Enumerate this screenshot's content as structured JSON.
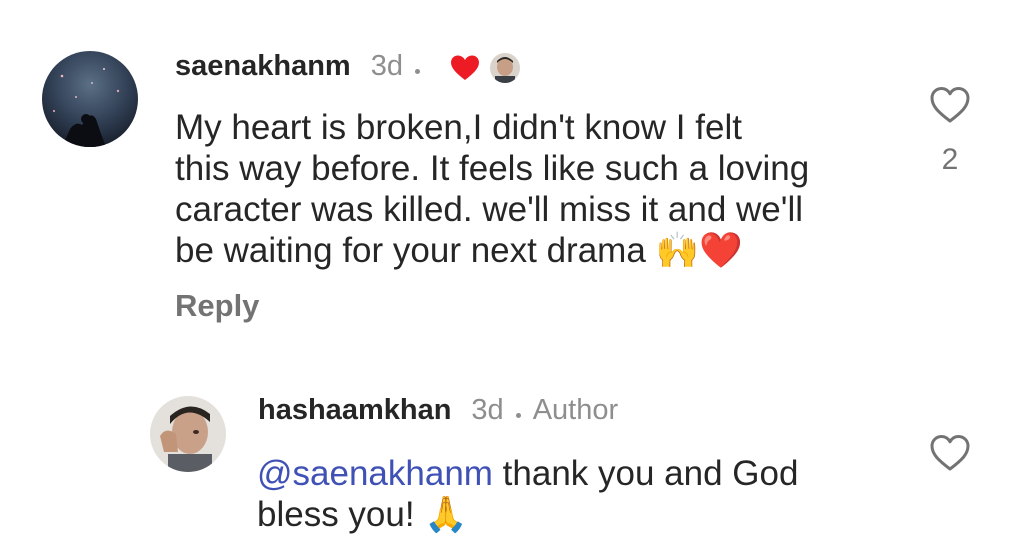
{
  "comments": [
    {
      "username": "saenakhanm",
      "time": "3d",
      "text": "My heart is broken,I didn't know I felt this way before. It feels like such a loving caracter was killed. we'll miss it and we'll be waiting for your next drama 🙌❤️",
      "lines": [
        "My heart is broken,I didn't know I felt",
        "this way before. It feels like such a loving",
        "caracter was killed. we'll miss it and we'll",
        "be waiting for your next drama 🙌❤️"
      ],
      "reply_label": "Reply",
      "like_count": "2",
      "liked_by_author": true
    },
    {
      "username": "hashaamkhan",
      "time": "3d",
      "badge": "Author",
      "mention": "@saenakhanm",
      "text_after_mention": " thank you and God",
      "line2": "bless you! 🙏"
    }
  ],
  "colors": {
    "text": "#262626",
    "meta": "#8e8e8e",
    "mention": "#3f51b5",
    "heart": "#ed1c24"
  }
}
